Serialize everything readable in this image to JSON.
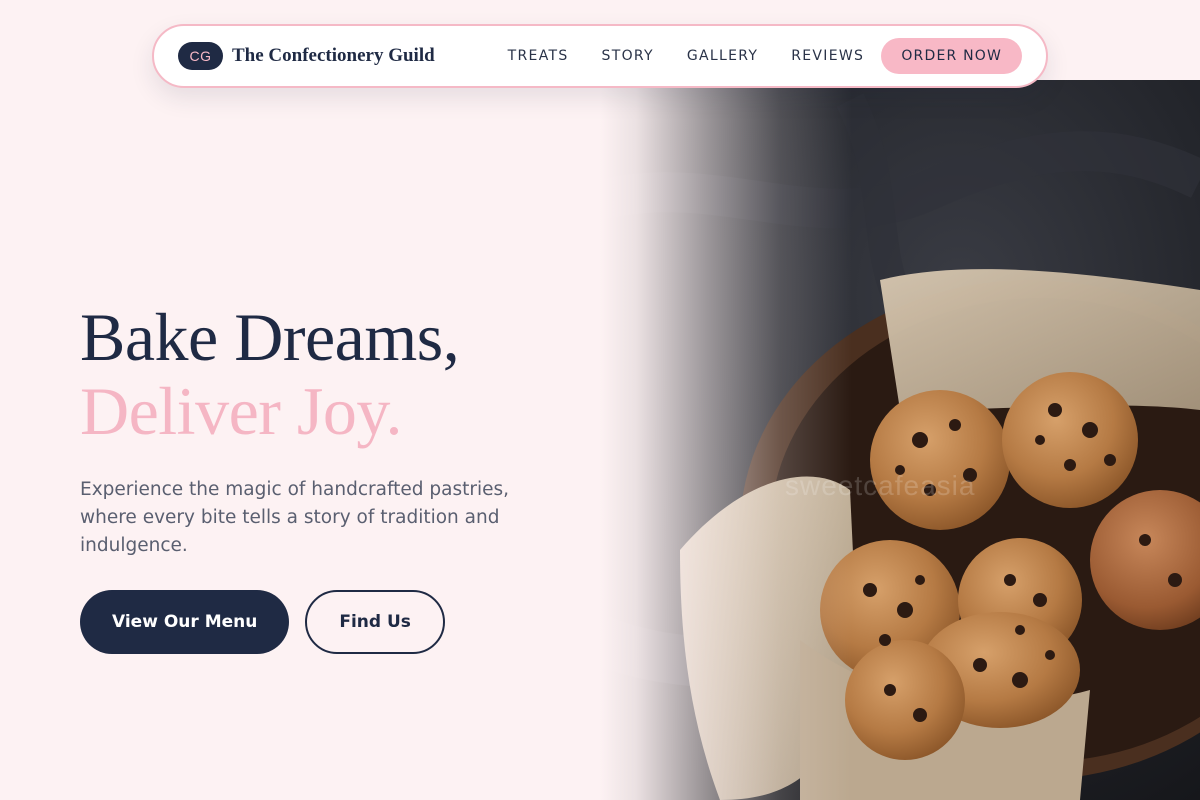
{
  "nav": {
    "logo_initials": "CG",
    "brand": "The Confectionery Guild",
    "links": [
      "TREATS",
      "STORY",
      "GALLERY",
      "REVIEWS"
    ],
    "cta": "ORDER NOW"
  },
  "hero": {
    "headline_line1": "Bake Dreams,",
    "headline_line2": "Deliver Joy.",
    "subtext": "Experience the magic of handcrafted pastries, where every bite tells a story of tradition and indulgence.",
    "primary_button": "View Our Menu",
    "secondary_button": "Find Us",
    "image_watermark": "sweetcafeasia"
  },
  "colors": {
    "background": "#fdf2f3",
    "navy": "#1f2a44",
    "pink": "#f8b8c6",
    "pink_text": "#f5b6c4",
    "body_text": "#5a5f70"
  }
}
